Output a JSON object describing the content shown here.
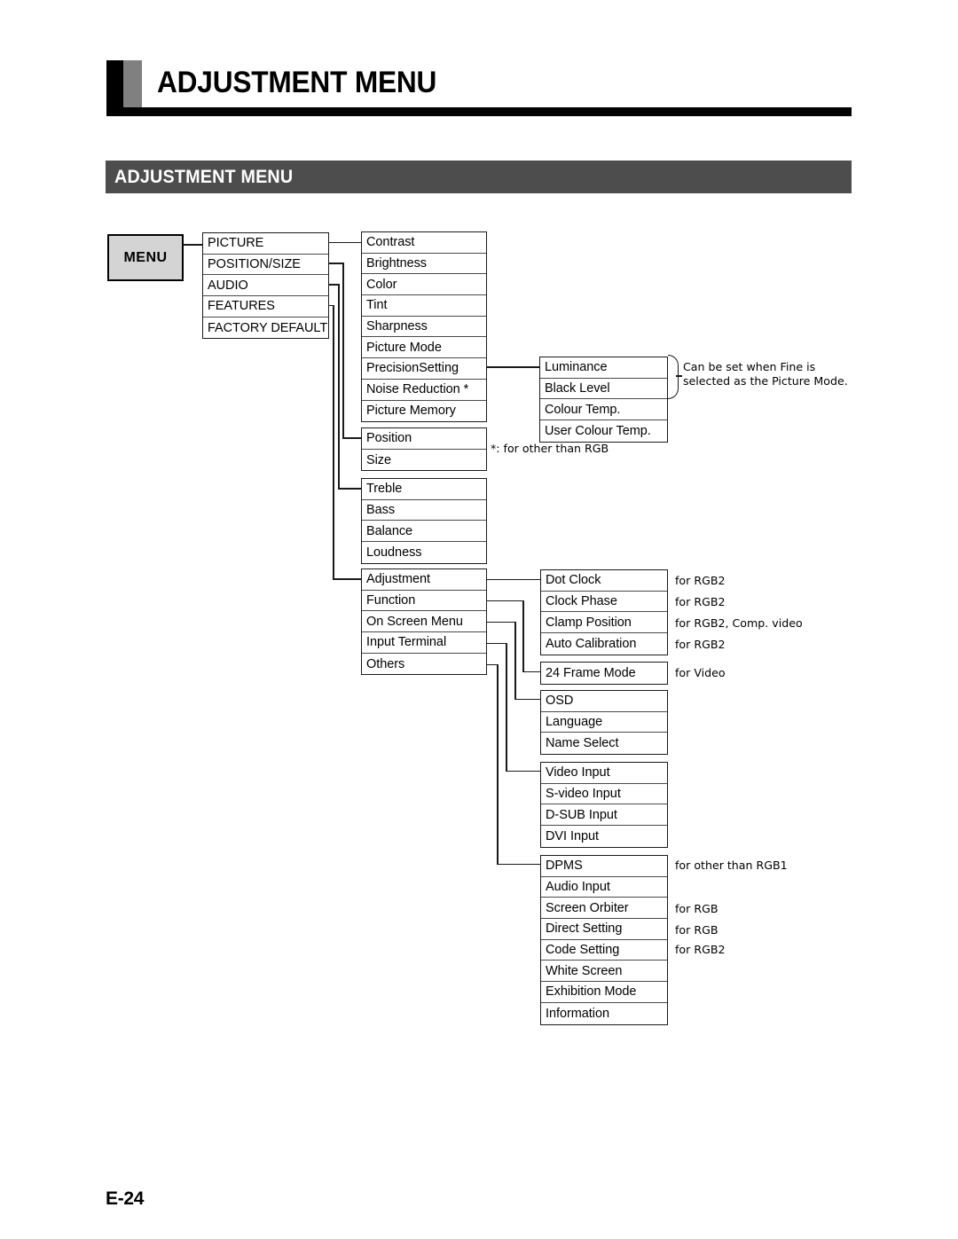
{
  "page": {
    "header_title": "ADJUSTMENT MENU",
    "section_banner": "ADJUSTMENT MENU",
    "footer": "E-24"
  },
  "diagram": {
    "root_label": "MENU",
    "columns": {
      "level1": {
        "name": "main-menu-items",
        "items": [
          "PICTURE",
          "POSITION/SIZE",
          "AUDIO",
          "FEATURES",
          "FACTORY DEFAULT"
        ]
      },
      "picture_group": {
        "name": "picture-submenu",
        "items": [
          "Contrast",
          "Brightness",
          "Color",
          "Tint",
          "Sharpness",
          "Picture Mode",
          "PrecisionSetting",
          "Noise Reduction *",
          "Picture Memory"
        ]
      },
      "precision_group": {
        "name": "precision-setting-submenu",
        "items": [
          "Luminance",
          "Black Level",
          "Colour Temp.",
          "User Colour Temp."
        ]
      },
      "position_size_group": {
        "name": "position-size-submenu",
        "items": [
          "Position",
          "Size"
        ]
      },
      "audio_group": {
        "name": "audio-submenu",
        "items": [
          "Treble",
          "Bass",
          "Balance",
          "Loudness"
        ]
      },
      "features_group": {
        "name": "features-submenu",
        "items": [
          "Adjustment",
          "Function",
          "On Screen Menu",
          "Input Terminal",
          "Others"
        ]
      },
      "adjustment_group": {
        "name": "adjustment-submenu",
        "items": [
          "Dot Clock",
          "Clock Phase",
          "Clamp Position",
          "Auto Calibration"
        ]
      },
      "function_group": {
        "name": "function-submenu",
        "items": [
          "24 Frame Mode"
        ]
      },
      "on_screen_menu_group": {
        "name": "on-screen-menu-submenu",
        "items": [
          "OSD",
          "Language",
          "Name Select"
        ]
      },
      "input_terminal_group": {
        "name": "input-terminal-submenu",
        "items": [
          "Video Input",
          "S-video Input",
          "D-SUB Input",
          "DVI Input"
        ]
      },
      "others_group": {
        "name": "others-submenu",
        "items": [
          "DPMS",
          "Audio Input",
          "Screen Orbiter",
          "Direct Setting",
          "Code Setting",
          "White Screen",
          "Exhibition Mode",
          "Information"
        ]
      }
    },
    "annotations": {
      "fine_note_line1": "Can be set when Fine is",
      "fine_note_line2": "selected as the Picture Mode.",
      "star_note": "*: for other than RGB",
      "dot_clock": "for RGB2",
      "clock_phase": "for RGB2",
      "clamp_position": "for RGB2, Comp. video",
      "auto_calibration": "for RGB2",
      "frame_mode": "for Video",
      "dpms": "for other than RGB1",
      "screen_orbiter": "for RGB",
      "direct_setting": "for RGB",
      "code_setting": "for RGB2"
    }
  },
  "colors": {
    "banner": "#4d4d4d",
    "menu_box_fill": "#d4d4d4",
    "stroke": "#1a1a1a",
    "accent_gray": "#808080"
  }
}
